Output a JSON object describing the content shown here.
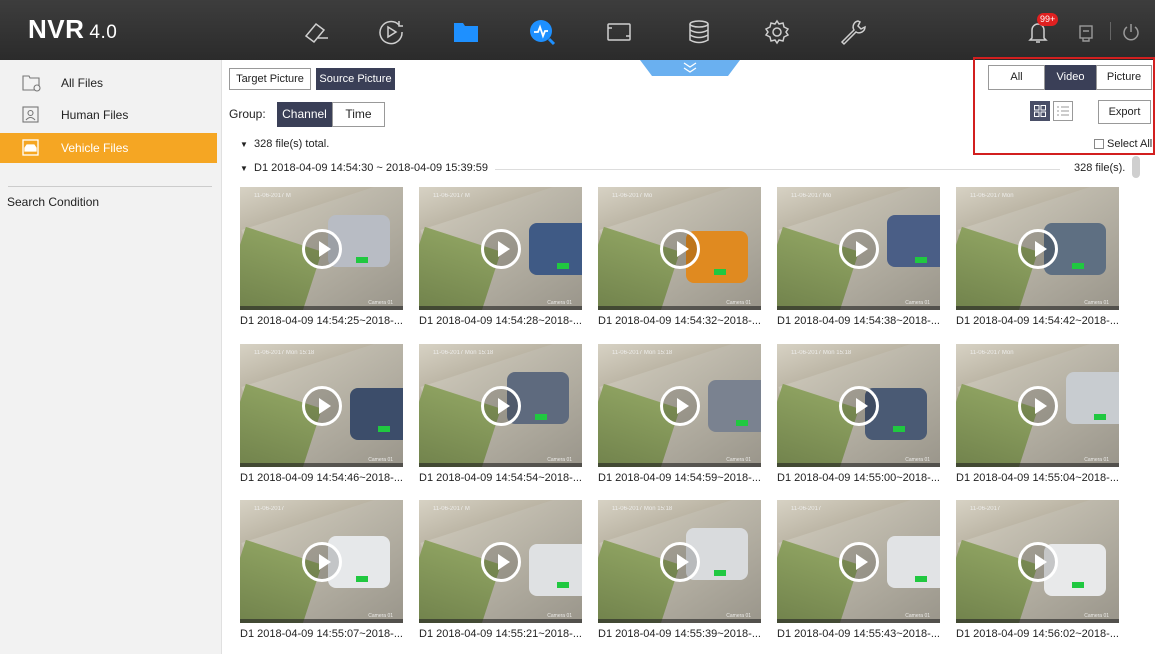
{
  "app": {
    "brand": "NVR",
    "version": "4.0",
    "notification_count": "99+"
  },
  "nav_icons": [
    "live-view-icon",
    "playback-icon",
    "file-management-icon",
    "smart-analysis-icon",
    "configuration-display-icon",
    "storage-icon",
    "settings-icon",
    "maintenance-icon"
  ],
  "sidebar": {
    "items": [
      {
        "label": "All Files",
        "icon": "all-files-icon"
      },
      {
        "label": "Human Files",
        "icon": "human-files-icon"
      },
      {
        "label": "Vehicle Files",
        "icon": "vehicle-files-icon",
        "active": true
      }
    ],
    "search_condition": "Search Condition"
  },
  "toolbar": {
    "target_picture": "Target Picture",
    "source_picture": "Source Picture",
    "group_label": "Group:",
    "group_channel": "Channel",
    "group_time": "Time",
    "filter_all": "All",
    "filter_video": "Video",
    "filter_picture": "Picture",
    "export": "Export",
    "select_all": "Select All"
  },
  "summary": {
    "total": "328 file(s) total.",
    "period": "D1 2018-04-09 14:54:30 ~ 2018-04-09 15:39:59",
    "period_count": "328 file(s)."
  },
  "files": [
    {
      "caption": "D1 2018-04-09 14:54:25~2018-...",
      "stamp": "11-06-2017 M"
    },
    {
      "caption": "D1 2018-04-09 14:54:28~2018-...",
      "stamp": "11-06-2017 M"
    },
    {
      "caption": "D1 2018-04-09 14:54:32~2018-...",
      "stamp": "11-06-2017 Mo"
    },
    {
      "caption": "D1 2018-04-09 14:54:38~2018-...",
      "stamp": "11-06-2017 Mo"
    },
    {
      "caption": "D1 2018-04-09 14:54:42~2018-...",
      "stamp": "11-06-2017 Mon"
    },
    {
      "caption": "D1 2018-04-09 14:54:46~2018-...",
      "stamp": "11-06-2017 Mon 15:18"
    },
    {
      "caption": "D1 2018-04-09 14:54:54~2018-...",
      "stamp": "11-06-2017 Mon 15:18"
    },
    {
      "caption": "D1 2018-04-09 14:54:59~2018-...",
      "stamp": "11-06-2017 Mon 15:18"
    },
    {
      "caption": "D1 2018-04-09 14:55:00~2018-...",
      "stamp": "11-06-2017 Mon 15:18"
    },
    {
      "caption": "D1 2018-04-09 14:55:04~2018-...",
      "stamp": "11-06-2017 Mon"
    },
    {
      "caption": "D1 2018-04-09 14:55:07~2018-...",
      "stamp": "11-06-2017"
    },
    {
      "caption": "D1 2018-04-09 14:55:21~2018-...",
      "stamp": "11-06-2017 M"
    },
    {
      "caption": "D1 2018-04-09 14:55:39~2018-...",
      "stamp": "11-06-2017 Mon 15:18"
    },
    {
      "caption": "D1 2018-04-09 14:55:43~2018-...",
      "stamp": "11-06-2017"
    },
    {
      "caption": "D1 2018-04-09 14:56:02~2018-...",
      "stamp": "11-06-2017"
    }
  ],
  "camera_label": "Camera 01",
  "colors": {
    "accent": "#f5a623",
    "topbar": "#333333",
    "selected_button": "#3a3f57",
    "highlight": "#d21f1f",
    "play_button": "#ffffff"
  }
}
